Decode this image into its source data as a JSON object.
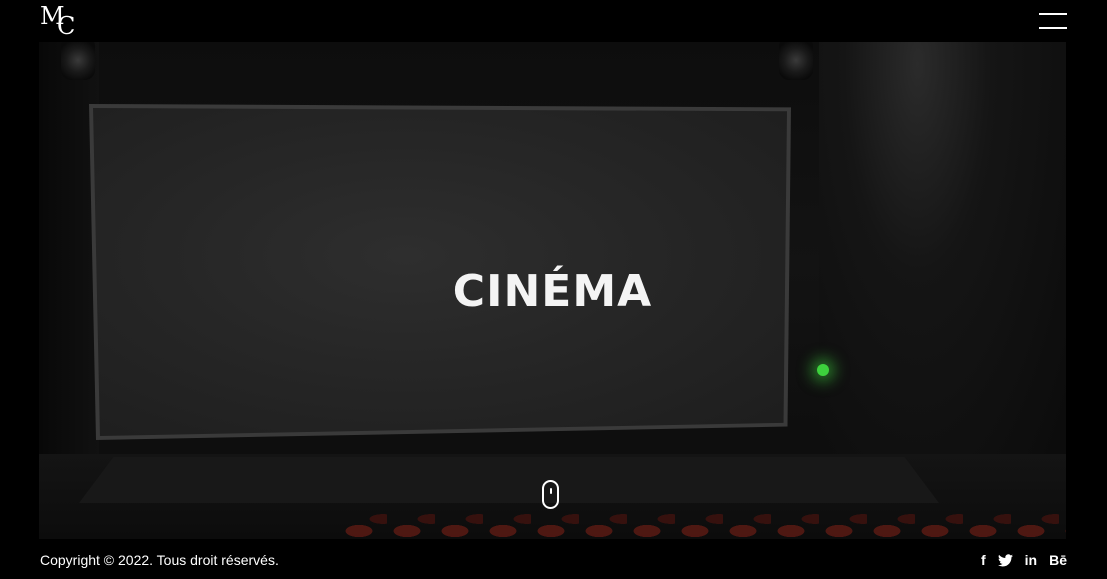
{
  "header": {
    "logo_text": "MC",
    "menu_icon": "hamburger-menu-icon"
  },
  "hero": {
    "title": "CINÉMA",
    "scroll_icon": "mouse-scroll-icon"
  },
  "footer": {
    "copyright": "Copyright © 2022. Tous droit réservés.",
    "social": [
      {
        "name": "facebook-icon",
        "label": "f"
      },
      {
        "name": "twitter-icon",
        "label": "twitter"
      },
      {
        "name": "linkedin-icon",
        "label": "in"
      },
      {
        "name": "behance-icon",
        "label": "Bē"
      }
    ]
  }
}
